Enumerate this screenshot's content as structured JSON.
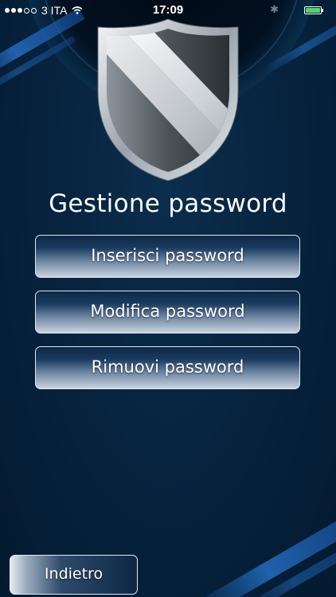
{
  "status_bar": {
    "carrier": "3 ITA",
    "time": "17:09",
    "battery_color": "#4cd964"
  },
  "main": {
    "title": "Gestione password",
    "buttons": [
      {
        "label": "Inserisci password"
      },
      {
        "label": "Modifica password"
      },
      {
        "label": "Rimuovi password"
      }
    ]
  },
  "footer": {
    "back_label": "Indietro"
  },
  "icons": {
    "logo": "shield-icon",
    "wifi": "wifi-icon",
    "bluetooth": "bluetooth-icon",
    "battery": "battery-icon"
  }
}
